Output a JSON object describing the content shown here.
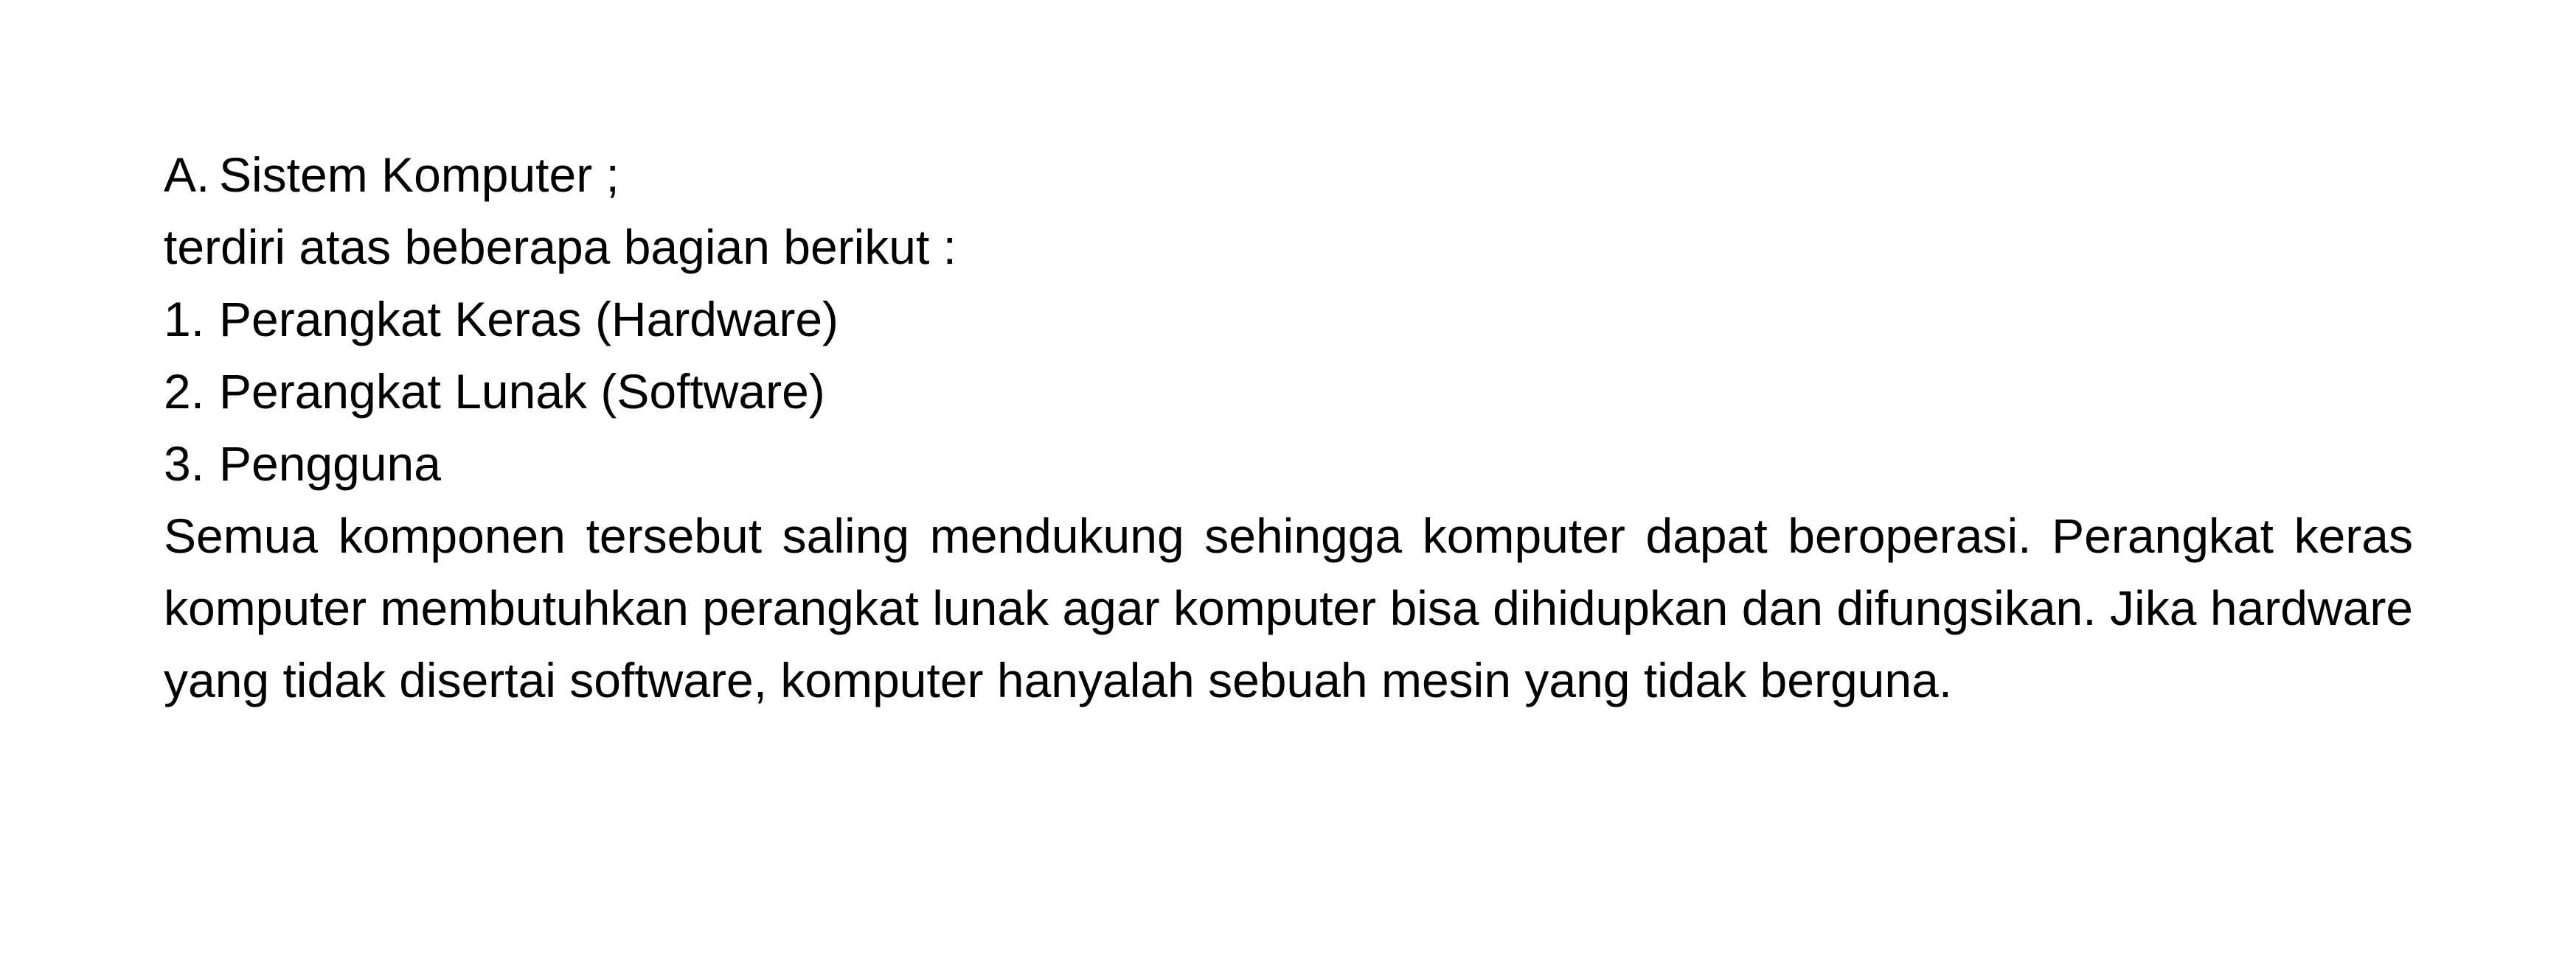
{
  "heading": {
    "marker": "A.",
    "text": "Sistem Komputer ;"
  },
  "intro": "terdiri atas beberapa bagian berikut :",
  "list": [
    {
      "marker": "1.",
      "text": "Perangkat Keras (Hardware)"
    },
    {
      "marker": "2.",
      "text": "Perangkat Lunak (Software)"
    },
    {
      "marker": "3.",
      "text": "Pengguna"
    }
  ],
  "paragraph": "Semua komponen tersebut saling mendukung sehingga komputer dapat beroperasi. Perangkat keras komputer membutuhkan perangkat lunak agar komputer bisa dihidup­kan dan difungsikan. Jika hardware yang tidak disertai software, komputer hanyalah sebuah mesin yang tidak berguna."
}
